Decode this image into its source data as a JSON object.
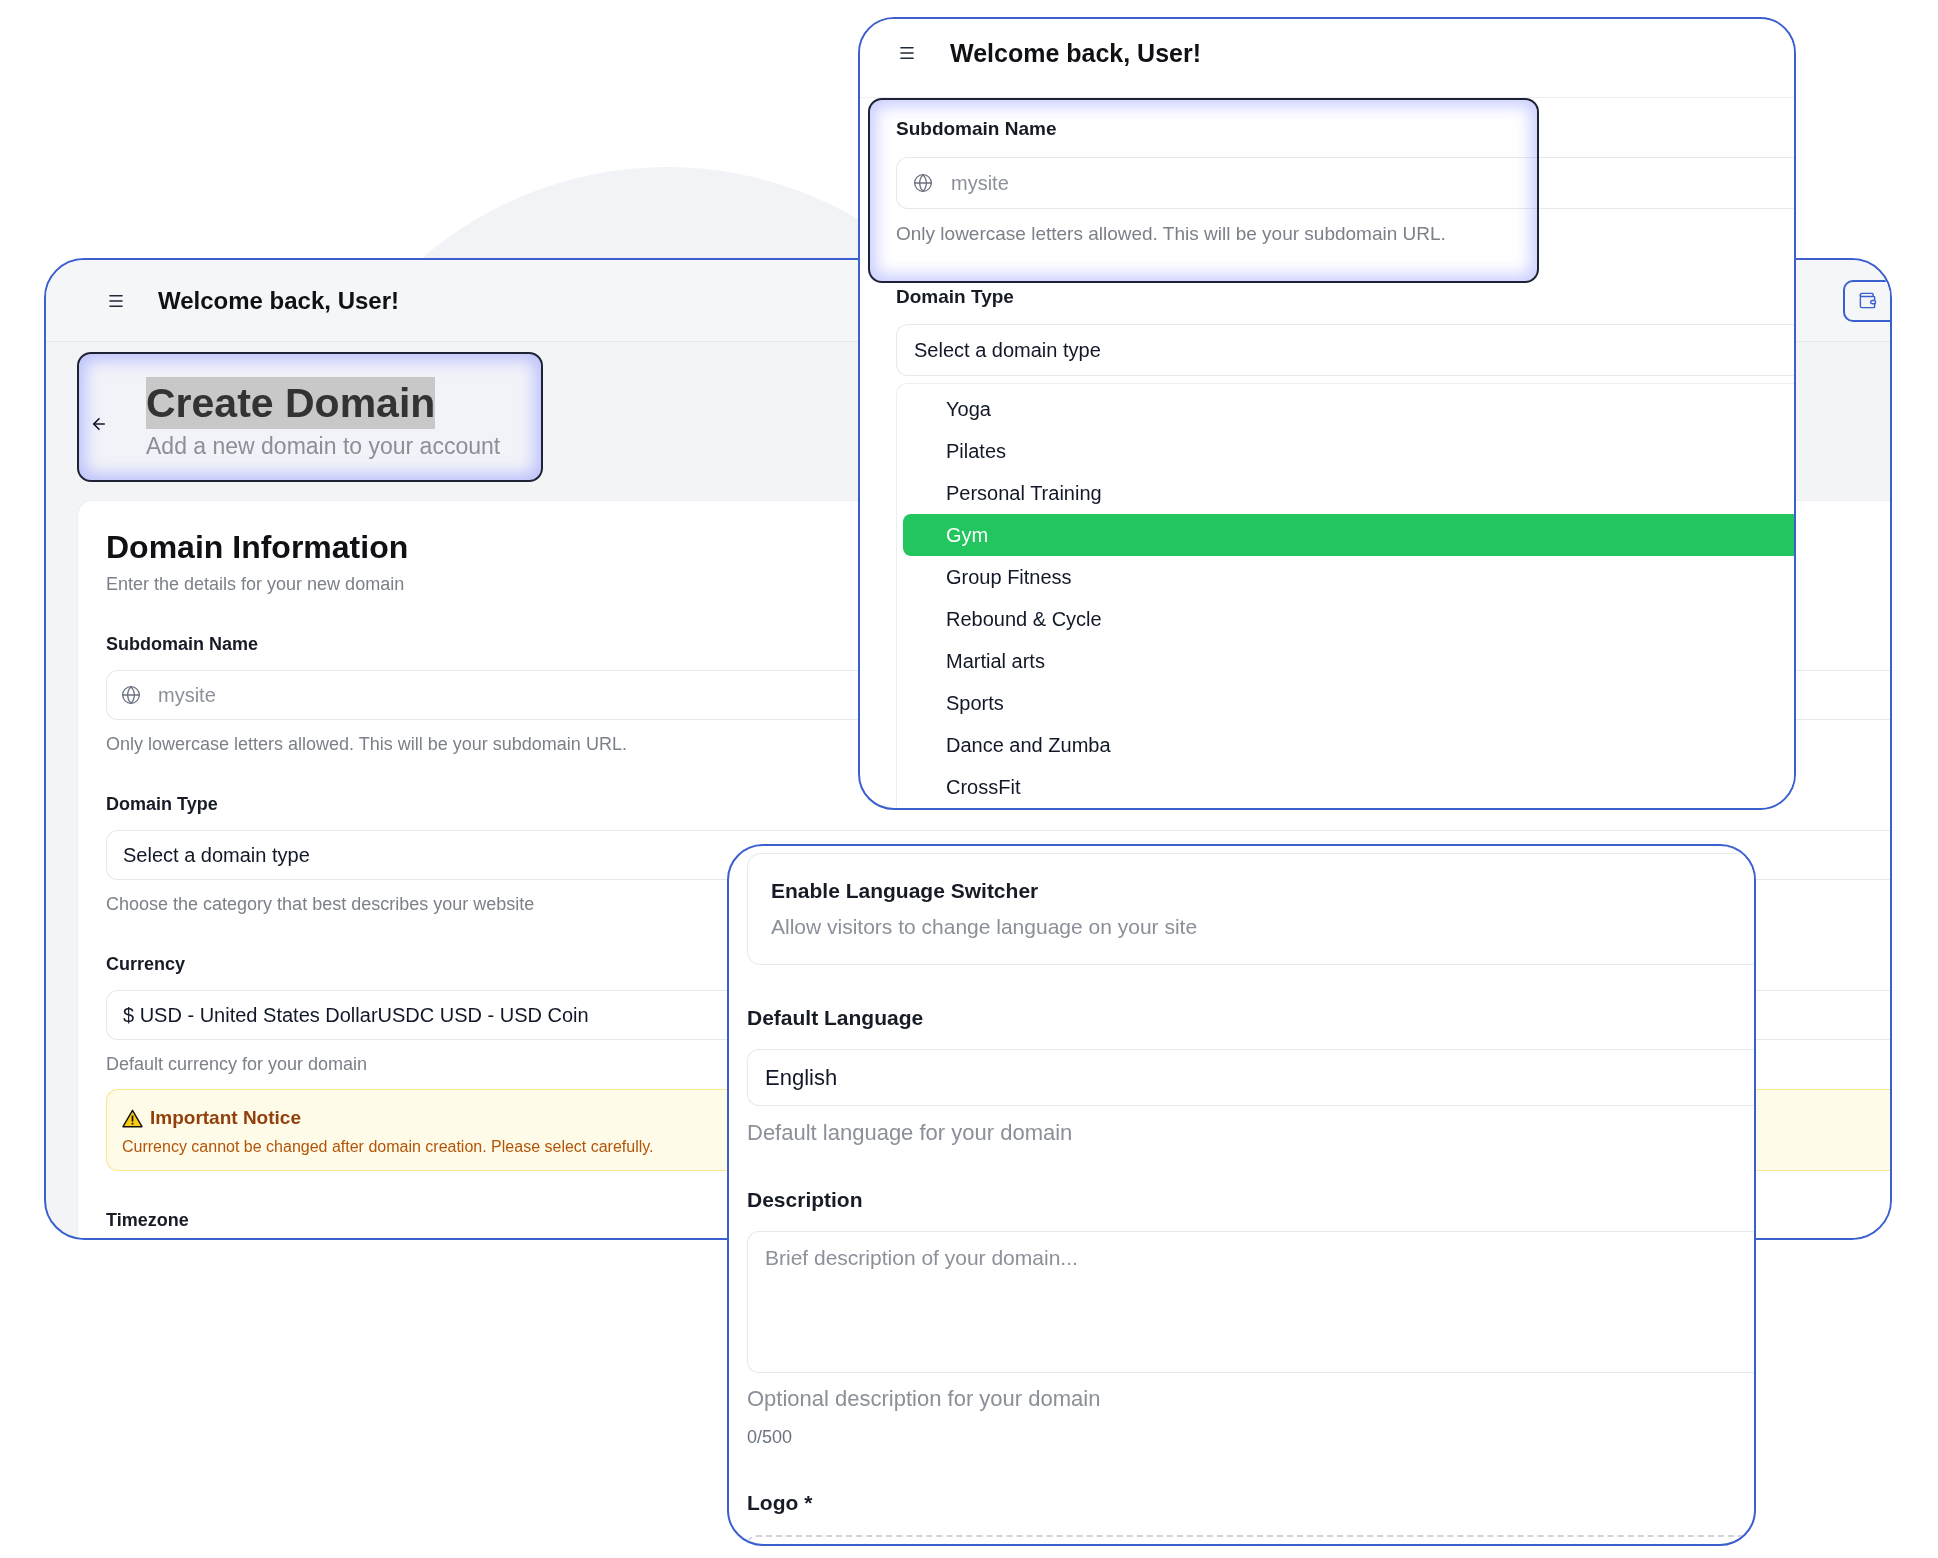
{
  "back_window": {
    "header": {
      "title": "Welcome back, User!"
    },
    "page_header": {
      "title": "Create Domain",
      "title_highlighted": true,
      "subtitle": "Add a new domain to your account"
    },
    "card": {
      "title": "Domain Information",
      "subtitle": "Enter the details for your new domain",
      "fields": [
        {
          "kind": "input",
          "label": "Subdomain Name",
          "placeholder": "mysite",
          "help": "Only lowercase letters allowed. This will be your subdomain URL."
        },
        {
          "kind": "select",
          "label": "Domain Type",
          "value": "Select a domain type",
          "help": "Choose the category that best describes your website"
        },
        {
          "kind": "select",
          "label": "Currency",
          "value": "$ USD - United States DollarUSDC USD - USD Coin",
          "help": "Default currency for your domain"
        },
        {
          "kind": "notice",
          "title": "Important Notice",
          "text": "Currency cannot be changed after domain creation. Please select carefully."
        },
        {
          "kind": "label",
          "label": "Timezone"
        }
      ]
    }
  },
  "top_window": {
    "header": {
      "title": "Welcome back, User!"
    },
    "fields": [
      {
        "kind": "input",
        "label": "Subdomain Name",
        "placeholder": "mysite",
        "help": "Only lowercase letters allowed. This will be your subdomain URL."
      },
      {
        "kind": "select",
        "label": "Domain Type",
        "value": "Select a domain type",
        "options": [
          {
            "label": "Yoga",
            "selected": false
          },
          {
            "label": "Pilates",
            "selected": false
          },
          {
            "label": "Personal Training",
            "selected": false
          },
          {
            "label": "Gym",
            "selected": true
          },
          {
            "label": "Group Fitness",
            "selected": false
          },
          {
            "label": "Rebound & Cycle",
            "selected": false
          },
          {
            "label": "Martial arts",
            "selected": false
          },
          {
            "label": "Sports",
            "selected": false
          },
          {
            "label": "Dance and Zumba",
            "selected": false
          },
          {
            "label": "CrossFit",
            "selected": false
          }
        ]
      }
    ]
  },
  "bottom_window": {
    "fields": [
      {
        "kind": "switch_card",
        "title": "Enable Language Switcher",
        "subtitle": "Allow visitors to change language on your site"
      },
      {
        "kind": "select",
        "label": "Default Language",
        "value": "English",
        "help": "Default language for your domain"
      },
      {
        "kind": "textarea",
        "label": "Description",
        "placeholder": "Brief description of your domain...",
        "help": "Optional description for your domain",
        "counter": "0/500"
      },
      {
        "kind": "upload",
        "label": "Logo *"
      }
    ]
  }
}
